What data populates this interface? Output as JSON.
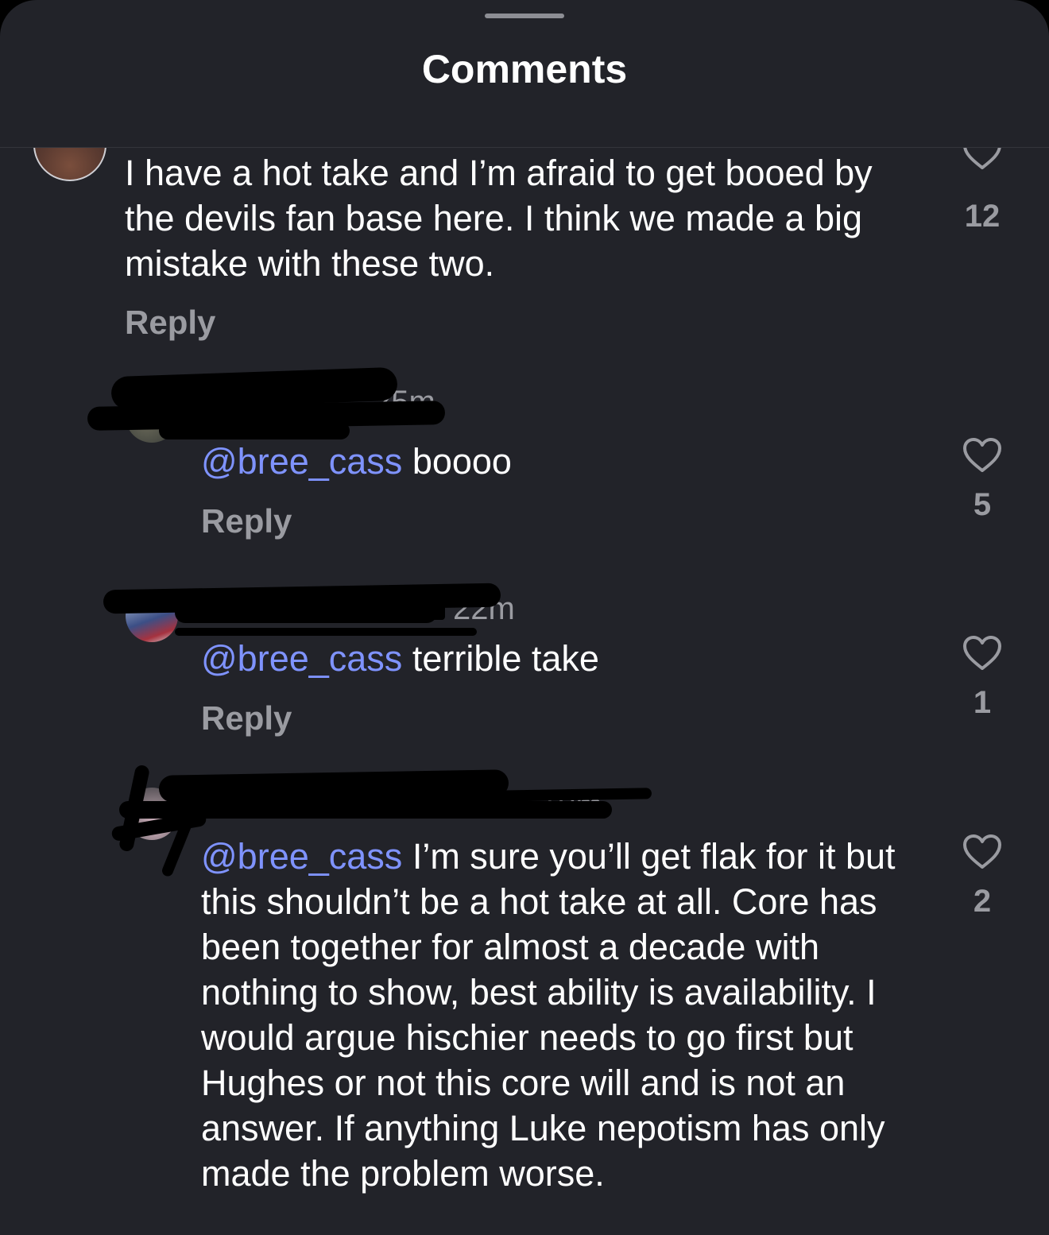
{
  "sheet": {
    "title": "Comments"
  },
  "comments": [
    {
      "text": "I have a hot take and I’m afraid to get booed by the devils fan base here. I think we made a big mistake with these two.",
      "reply_label": "Reply",
      "likes": "12"
    },
    {
      "timestamp": "25m",
      "mention": "@bree_cass",
      "text": " boooo",
      "reply_label": "Reply",
      "likes": "5"
    },
    {
      "timestamp": "22m",
      "mention": "@bree_cass",
      "text": " terrible take",
      "reply_label": "Reply",
      "likes": "1"
    },
    {
      "timestamp": "19m",
      "mention": "@bree_cass",
      "text": " I’m sure you’ll get flak for it but this shouldn’t be a hot take at all. Core has been together for almost a decade with nothing to show, best ability is availability. I would argue hischier needs to go first but Hughes or not this core will and is not an answer. If anything Luke nepotism has only made the problem worse.",
      "likes": "2"
    }
  ],
  "icons": {
    "like": "heart-outline-icon",
    "grabber": "drag-handle"
  },
  "colors": {
    "background": "#222329",
    "mention": "#7f93ff",
    "secondary_text": "#9a9ba1",
    "redaction": "#000000"
  }
}
